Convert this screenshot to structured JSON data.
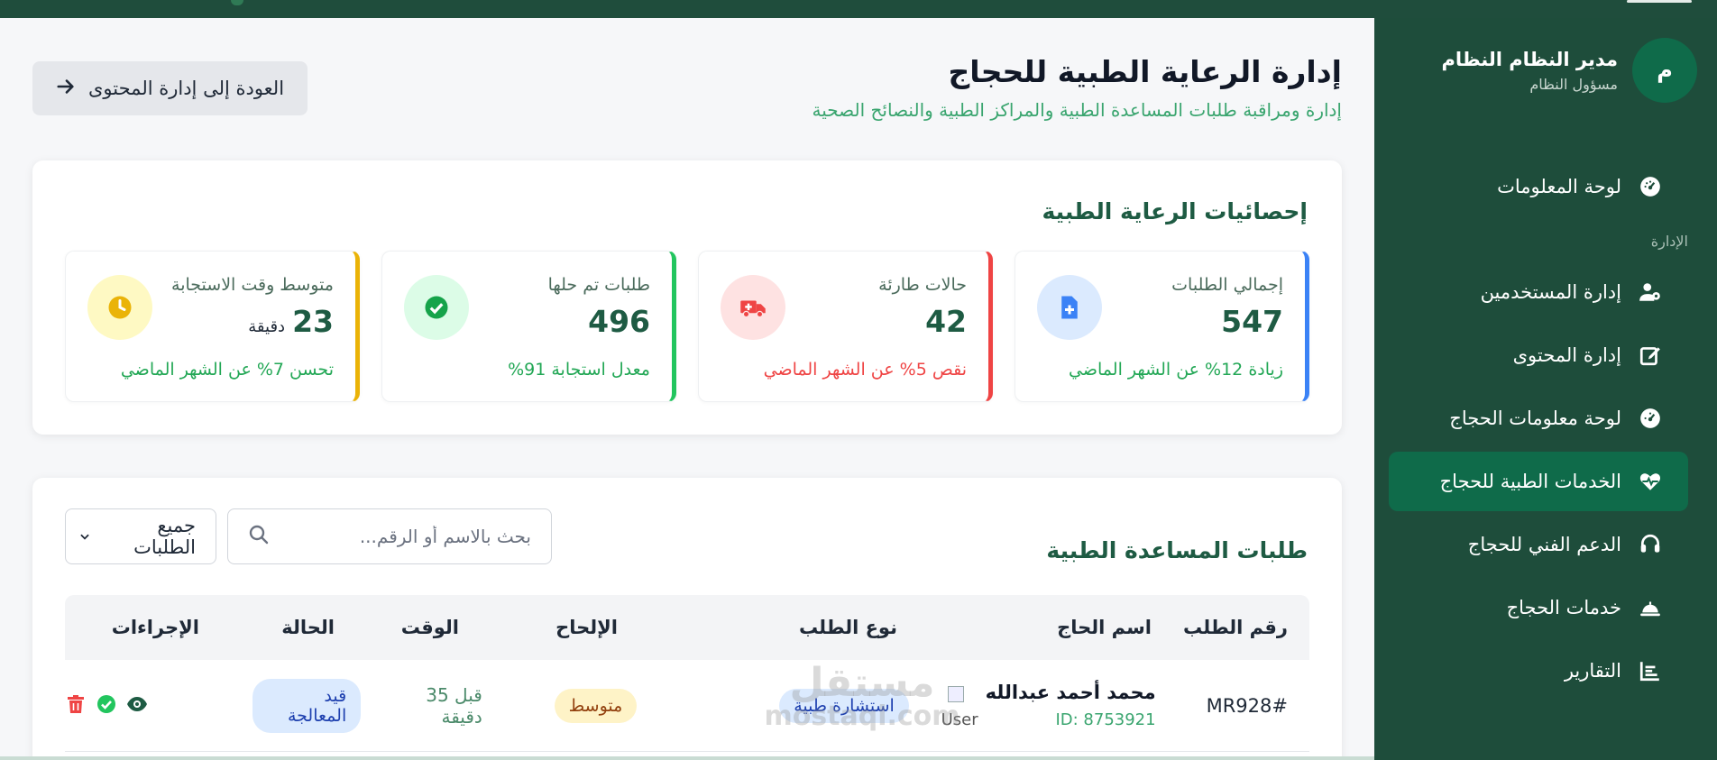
{
  "colors": {
    "sidebar_bg": "#1e4d3b",
    "active_item": "#0f6b4a",
    "accent_green": "#3aa56f",
    "blue": "#3b82f6",
    "red": "#ef4444",
    "green": "#22c55e",
    "yellow": "#eab308"
  },
  "sidebar": {
    "profile": {
      "initial": "م",
      "name": "مدير النظام النظام",
      "role": "مسؤول النظام"
    },
    "items": [
      {
        "label": "لوحة المعلومات",
        "icon": "dashboard-gauge-icon",
        "active": false
      },
      {
        "section": "الإدارة"
      },
      {
        "label": "إدارة المستخدمين",
        "icon": "users-cog-icon",
        "active": false
      },
      {
        "label": "إدارة المحتوى",
        "icon": "edit-icon",
        "active": false
      },
      {
        "label": "لوحة معلومات الحجاج",
        "icon": "dashboard-gauge-icon",
        "active": false
      },
      {
        "label": "الخدمات الطبية للحجاج",
        "icon": "heartbeat-icon",
        "active": true
      },
      {
        "label": "الدعم الفني للحجاج",
        "icon": "headset-icon",
        "active": false
      },
      {
        "label": "خدمات الحجاج",
        "icon": "bell-concierge-icon",
        "active": false
      },
      {
        "label": "التقارير",
        "icon": "chart-icon",
        "active": false
      }
    ]
  },
  "header": {
    "title": "إدارة الرعاية الطبية للحجاج",
    "subtitle": "إدارة ومراقبة طلبات المساعدة الطبية والمراكز الطبية والنصائح الصحية",
    "back_label": "العودة إلى إدارة المحتوى"
  },
  "stats": {
    "title": "إحصائيات الرعاية الطبية",
    "cards": [
      {
        "label": "إجمالي الطلبات",
        "value": "547",
        "unit": "",
        "note": "زيادة 12% عن الشهر الماضي",
        "icon": "file-medical-icon",
        "color": "#3b82f6",
        "note_color": "#22a755"
      },
      {
        "label": "حالات طارئة",
        "value": "42",
        "unit": "",
        "note": "نقص 5% عن الشهر الماضي",
        "icon": "ambulance-icon",
        "color": "#ef4444",
        "note_color": "#ef4444"
      },
      {
        "label": "طلبات تم حلها",
        "value": "496",
        "unit": "",
        "note": "معدل استجابة 91%",
        "icon": "check-circle-icon",
        "color": "#22c55e",
        "note_color": "#22a755"
      },
      {
        "label": "متوسط وقت الاستجابة",
        "value": "23",
        "unit": "دقيقة",
        "note": "تحسن 7% عن الشهر الماضي",
        "icon": "clock-icon",
        "color": "#eab308",
        "note_color": "#22a755"
      }
    ]
  },
  "requests": {
    "title": "طلبات المساعدة الطبية",
    "search_placeholder": "بحث بالاسم أو الرقم...",
    "filter_value": "جميع الطلبات",
    "columns": [
      "رقم الطلب",
      "اسم الحاج",
      "نوع الطلب",
      "الإلحاح",
      "الوقت",
      "الحالة",
      "الإجراءات"
    ],
    "rows": [
      {
        "id": "#MR928",
        "name": "محمد أحمد عبدالله",
        "pid": "ID: 8753921",
        "img_alt": "User",
        "type": "استشارة طبية",
        "urgency": "متوسط",
        "time": "قبل 35 دقيقة",
        "status": "قيد المعالجة"
      }
    ]
  },
  "watermark": {
    "line1": "مستقل",
    "line2": "mostaql.com"
  }
}
